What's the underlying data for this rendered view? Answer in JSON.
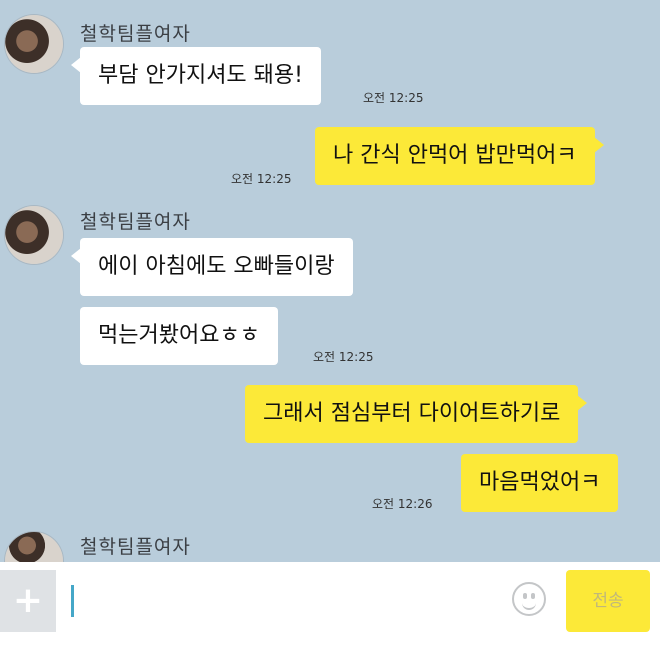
{
  "chat": {
    "sender_name": "철학팀플여자",
    "messages": [
      {
        "text": "부담 안가지셔도 돼용!",
        "time": "오전 12:25"
      },
      {
        "text": "나 간식 안먹어 밥만먹어ㅋ",
        "time": "오전 12:25"
      },
      {
        "text": "에이 아침에도 오빠들이랑"
      },
      {
        "text": "먹는거봤어요ㅎㅎ",
        "time": "오전 12:25"
      },
      {
        "text": "그래서 점심부터 다이어트하기로"
      },
      {
        "text": "마음먹었어ㅋ",
        "time": "오전 12:26"
      }
    ]
  },
  "input_bar": {
    "plus_label": "+",
    "send_label": "전송"
  },
  "colors": {
    "chat_background": "#b9cddb",
    "outgoing_bubble": "#fce938",
    "incoming_bubble": "#ffffff"
  },
  "icons": [
    "avatar",
    "plus-icon",
    "emoji-icon"
  ]
}
